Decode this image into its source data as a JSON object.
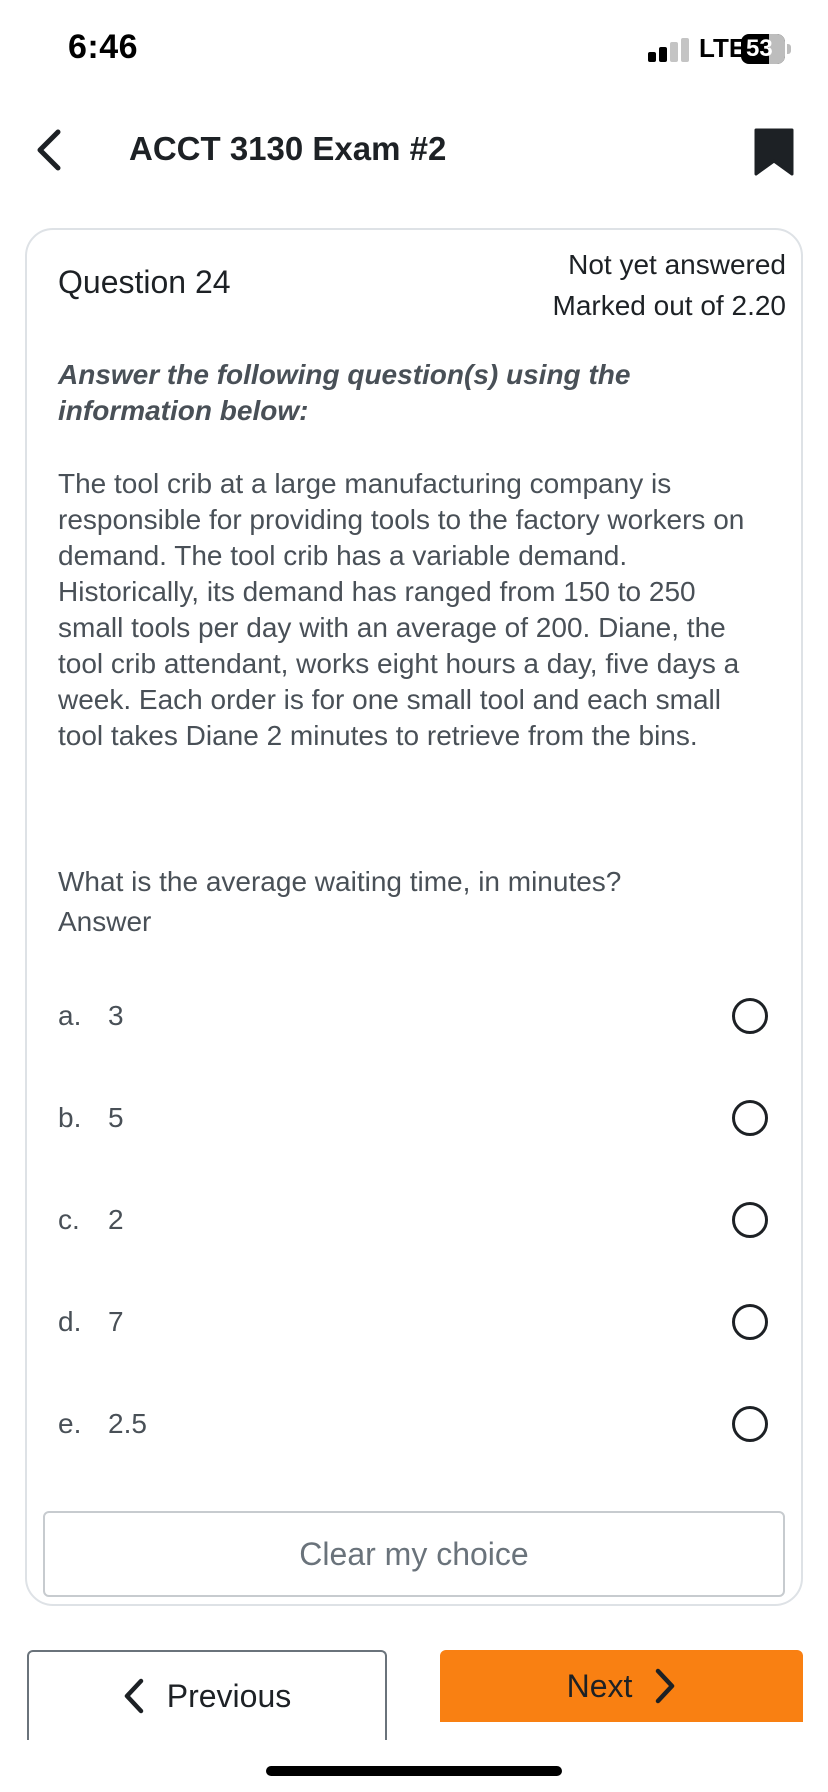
{
  "status_bar": {
    "time": "6:46",
    "network": "LTE",
    "battery": "53",
    "signal_bars_active": 2,
    "signal_bars_total": 4
  },
  "header": {
    "title": "ACCT 3130 Exam #2",
    "back_icon": "chevron-left-icon",
    "bookmark_icon": "bookmark-icon"
  },
  "question": {
    "number_label": "Question 24",
    "status": "Not yet answered",
    "marks": "Marked out of 2.20",
    "intro": "Answer the following question(s) using the information below:",
    "passage": "The tool crib at a large manufacturing company is responsible for providing tools to the factory workers on demand. The tool crib has a variable demand. Historically, its demand has ranged from 150 to 250 small tools per day with an average of 200. Diane, the tool crib attendant, works eight hours a day, five days a week. Each order is for one small tool and each small tool takes Diane 2 minutes to retrieve from the bins.",
    "prompt": "What is the average waiting time, in minutes?",
    "answer_label": "Answer",
    "options": [
      {
        "letter": "a.",
        "value": "3"
      },
      {
        "letter": "b.",
        "value": "5"
      },
      {
        "letter": "c.",
        "value": "2"
      },
      {
        "letter": "d.",
        "value": "7"
      },
      {
        "letter": "e.",
        "value": "2.5"
      }
    ],
    "clear_label": "Clear my choice"
  },
  "navigation": {
    "previous_label": "Previous",
    "next_label": "Next"
  },
  "colors": {
    "accent": "#f98012",
    "text": "#1d2125",
    "muted_text": "#495057",
    "border": "#dee2e6"
  }
}
